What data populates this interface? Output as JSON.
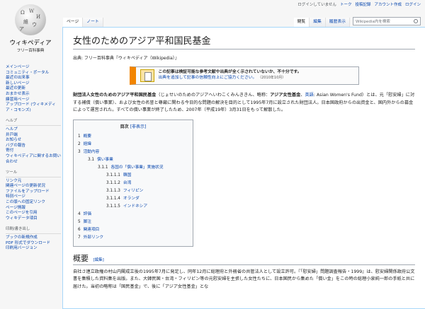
{
  "personal": {
    "anon": "ログインしていません",
    "talk": "トーク",
    "contribs": "投稿記録",
    "create": "アカウント作成",
    "login": "ログイン"
  },
  "logo": {
    "wordmark": "ウィキペディア",
    "tagline": "フリー百科事典"
  },
  "sidebar": {
    "main": [
      "メインページ",
      "コミュニティ・ポータル",
      "最近の出来事",
      "新しいページ",
      "最近の更新",
      "おまかせ表示",
      "練習用ページ",
      "アップロード (ウィキメディア・コモンズ)"
    ],
    "help_heading": "ヘルプ",
    "help": [
      "ヘルプ",
      "井戸端",
      "お知らせ",
      "バグの報告",
      "寄付",
      "ウィキペディアに関するお問い合わせ"
    ],
    "tools_heading": "ツール",
    "tools": [
      "リンク元",
      "関連ページの更新状況",
      "ファイルをアップロード",
      "特別ページ",
      "この版への固定リンク",
      "ページ情報",
      "このページを引用",
      "ウィキデータ項目"
    ],
    "print_heading": "印刷/書き出し",
    "print": [
      "ブックの新規作成",
      "PDF 形式でダウンロード",
      "印刷用バージョン"
    ]
  },
  "tabs": {
    "left": [
      "ページ",
      "ノート"
    ],
    "right": [
      "閲覧",
      "編集",
      "履歴表示"
    ],
    "selected": "ページ"
  },
  "search": {
    "placeholder": "Wikipedia内を検索"
  },
  "article": {
    "title": "女性のためのアジア平和国民基金",
    "site_sub": "出典: フリー百科事典『ウィキペディア（Wikipedia）』",
    "ambox": {
      "line1": "この記事は検証可能な参考文献や出典が全く示されていないか、不十分です。",
      "line2": "出典を追加して記事の信頼性向上にご協力ください。",
      "date": "（2010年10月）"
    },
    "lead_bold1": "財団法人女性のためのアジア平和国民基金",
    "lead_text1": "（じょせいのためのアジアへいわこくみんききん、略称：",
    "lead_bold2": "アジア女性基金",
    "lead_text2": "、",
    "lead_link1": "英語",
    "lead_text3": ": Asian Women's Fund）とは、元「慰安婦」に対する補償（償い事業）、および女性の名誉と尊厳に関わる今日的な問題の解決を目的として1995年7月に設立された財団法人。日本国政府からの出資金と、国内外からの募金によって運営された。すべての償い事業が終了したため、2007年（平成19年）3月31日をもって解散した。",
    "toc": {
      "title": "目次",
      "toggle": "[非表示]",
      "items": [
        {
          "num": "1",
          "label": "概要",
          "level": 0
        },
        {
          "num": "2",
          "label": "経緯",
          "level": 0
        },
        {
          "num": "3",
          "label": "活動内容",
          "level": 0
        },
        {
          "num": "3.1",
          "label": "償い事業",
          "level": 1
        },
        {
          "num": "3.1.1",
          "label": "各国の「償い事業」実施状況",
          "level": 2
        },
        {
          "num": "3.1.1.1",
          "label": "韓国",
          "level": 3
        },
        {
          "num": "3.1.1.2",
          "label": "台湾",
          "level": 3
        },
        {
          "num": "3.1.1.3",
          "label": "フィリピン",
          "level": 3
        },
        {
          "num": "3.1.1.4",
          "label": "オランダ",
          "level": 3
        },
        {
          "num": "3.1.1.5",
          "label": "インドネシア",
          "level": 3
        },
        {
          "num": "4",
          "label": "評価",
          "level": 0
        },
        {
          "num": "5",
          "label": "脚注",
          "level": 0
        },
        {
          "num": "6",
          "label": "関連項目",
          "level": 0
        },
        {
          "num": "7",
          "label": "外部リンク",
          "level": 0
        }
      ]
    },
    "section1": {
      "title": "概要",
      "edit": "[編集]",
      "text": "自社さ連立政権の村山内閣成立後の1995年7月に発足し、同年12月に総理府と外務省の共管法人として設立許可。『「慰安婦」問題調査報告・1999』は、慰安婦関係政府公文書を集積した資料集を出版。また、大韓民国・台湾・フィリピン等の元慰安婦を主張した女性たちに、日本国民から集めた「償い金」をこの時の総理小泉純一郎の手紙と共に届けた。当初の略称は「国民基金」で、後に「アジア女性基金」とな"
    }
  }
}
